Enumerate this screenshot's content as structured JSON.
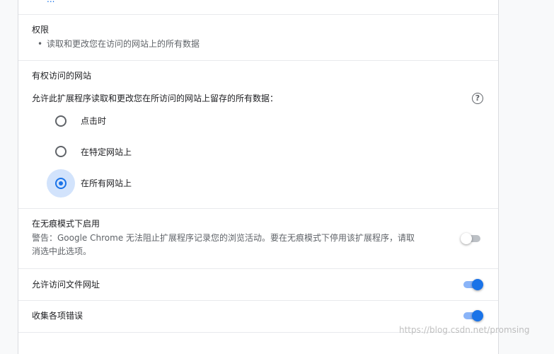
{
  "top_link": "...",
  "permissions": {
    "title": "权限",
    "item": "读取和更改您在访问的网站上的所有数据"
  },
  "site_access": {
    "title": "有权访问的网站",
    "description": "允许此扩展程序读取和更改您在所访问的网站上留存的所有数据：",
    "help_icon": "?",
    "options": [
      {
        "label": "点击时",
        "checked": false
      },
      {
        "label": "在特定网站上",
        "checked": false
      },
      {
        "label": "在所有网站上",
        "checked": true
      }
    ]
  },
  "incognito": {
    "title": "在无痕模式下启用",
    "warning_line1": "警告：Google Chrome 无法阻止扩展程序记录您的浏览活动。要在无痕模式下停用该扩展程序，请取",
    "warning_line2": "消选中此选项。",
    "enabled": false
  },
  "file_urls": {
    "title": "允许访问文件网址",
    "enabled": true
  },
  "collect_errors": {
    "title": "收集各项错误",
    "enabled": true
  },
  "watermark": "https://blog.csdn.net/promsing",
  "colors": {
    "accent": "#1a73e8",
    "toggle_track_on": "#8ab4f8",
    "radio_halo": "#d2e3fc"
  }
}
